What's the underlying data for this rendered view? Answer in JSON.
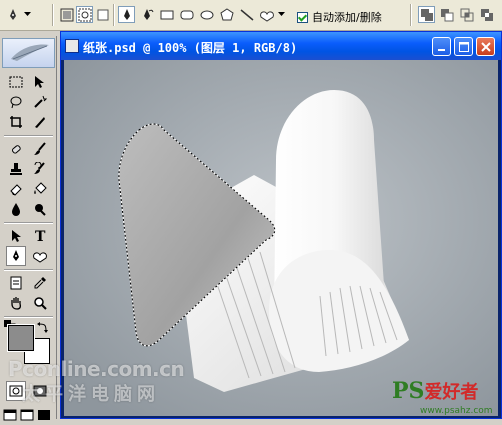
{
  "options_bar": {
    "tool_preset": "pen-tool-icon",
    "path_modes": [
      "shape-layers-icon",
      "paths-icon",
      "fill-pixels-icon"
    ],
    "draw_modes": [
      "pen-tool-icon",
      "freeform-pen-icon",
      "rectangle-icon",
      "rounded-rectangle-icon",
      "ellipse-icon",
      "polygon-icon",
      "line-icon",
      "custom-shape-icon"
    ],
    "auto_add_delete_label": "自动添加/删除",
    "auto_add_delete_checked": true,
    "path_ops": [
      "add-to-path-icon",
      "subtract-from-path-icon",
      "intersect-path-icon",
      "exclude-overlap-icon"
    ]
  },
  "tools": {
    "active": "pen-tool",
    "foreground_color": "#8c8c8c",
    "background_color": "#ffffff"
  },
  "document": {
    "title": "纸张.psd @ 100% (图层 1, RGB/8)",
    "colors": {
      "canvas_bg": "#a7aeb4",
      "paper": "#f1f1f1",
      "triangle": "#a9a9a9"
    }
  },
  "watermarks": {
    "left_line1": "Pconline.com.cn",
    "left_line2": "太平洋电脑网",
    "right_brand": "PS",
    "right_sub": "爱好者",
    "right_url": "www.psahz.com"
  }
}
